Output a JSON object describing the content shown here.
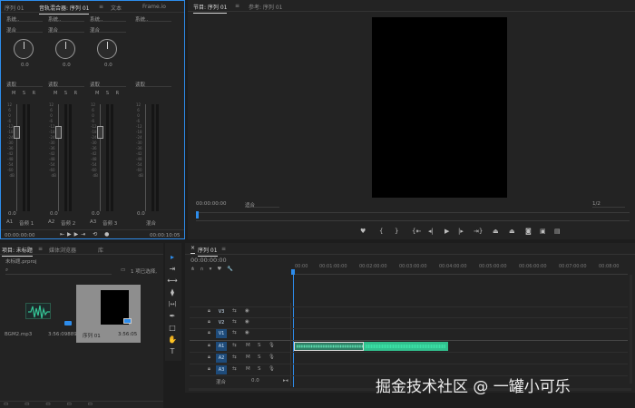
{
  "audio_mixer": {
    "tabs": [
      "序列 01",
      "音轨混合器: 序列 01",
      "≡",
      "文本",
      "Frame.io"
    ],
    "channels": [
      {
        "mode": "系统..",
        "blend": "混合",
        "pan": "0.0",
        "auto": "读取",
        "scale_top": "dB",
        "value": "0.0",
        "label": "A1",
        "name": "音频 1"
      },
      {
        "mode": "系统..",
        "blend": "混合",
        "pan": "0.0",
        "auto": "读取",
        "scale_top": "dB",
        "value": "0.0",
        "label": "A2",
        "name": "音频 2"
      },
      {
        "mode": "系统..",
        "blend": "混合",
        "pan": "0.0",
        "auto": "读取",
        "scale_top": "dB",
        "value": "0.0",
        "label": "A3",
        "name": "音频 3"
      },
      {
        "mode": "系统..",
        "blend": "混合",
        "pan": "",
        "auto": "读取",
        "scale_top": "dB",
        "value": "0.0",
        "label": "",
        "name": "混合"
      }
    ],
    "msr": "M S R",
    "scale_values": "12\n 6\n 0\n-6\n-12\n-18\n-24\n-30\n-36\n-42\n-48\n-54\n-60\n  dB",
    "timecode": "00:00:00:00",
    "end_timecode": "00:00:10:05"
  },
  "program_monitor": {
    "tabs": [
      "节目: 序列 01",
      "≡",
      "参考: 序列 01"
    ],
    "timecode": "00:00:00:00",
    "fit": "适合",
    "resolution": "1/2"
  },
  "project_panel": {
    "tabs": [
      "项目: 未标题",
      "≡",
      "媒体浏览器",
      "库"
    ],
    "project_name": "未标题.prproj",
    "selection": "1 项已选择,",
    "items": [
      {
        "name": "BGM2.mp3",
        "duration": "3:56:09889"
      },
      {
        "name": "序列 01",
        "duration": "3:56:05"
      }
    ]
  },
  "tools": [
    "▸",
    "⇥",
    "⟷",
    "⧫",
    "|↔|",
    "✒",
    "□",
    "✋",
    "T"
  ],
  "timeline": {
    "tab": "序列 01",
    "timecode": "00:00:00:00",
    "ruler": [
      "00:00",
      "00:01:00:00",
      "00:02:00:00",
      "00:03:00:00",
      "00:04:00:00",
      "00:05:00:00",
      "00:06:00:00",
      "00:07:00:00",
      "00:08:00"
    ],
    "tracks": [
      {
        "name": "V3",
        "selected": false
      },
      {
        "name": "V2",
        "selected": false
      },
      {
        "name": "V1",
        "selected": true
      },
      {
        "name": "A1",
        "selected": true
      },
      {
        "name": "A2",
        "selected": true
      },
      {
        "name": "A3",
        "selected": true
      }
    ],
    "mix_label": "混合",
    "mix_value": "0.0"
  },
  "watermark": "掘金技术社区 @ 一罐小可乐",
  "colors": {
    "accent": "#2d8ceb",
    "clip": "#31c08e",
    "panel": "#232323",
    "bg": "#1d1d1d"
  }
}
